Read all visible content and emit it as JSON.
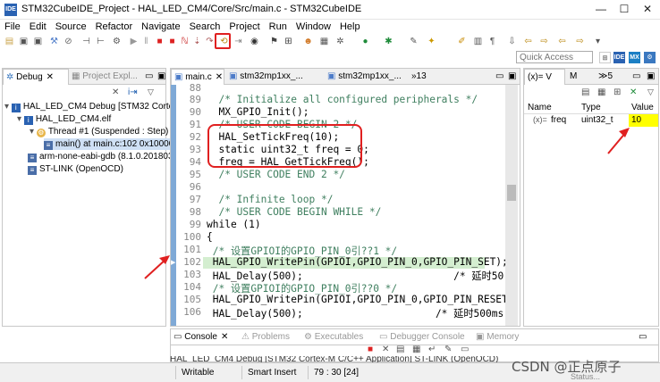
{
  "window": {
    "title": "STM32CubeIDE_Project - HAL_LED_CM4/Core/Src/main.c - STM32CubeIDE",
    "minimize": "—",
    "maximize": "☐",
    "close": "✕",
    "ide_icon": "IDE"
  },
  "menu": [
    "File",
    "Edit",
    "Source",
    "Refactor",
    "Navigate",
    "Search",
    "Project",
    "Run",
    "Window",
    "Help"
  ],
  "quick_access": {
    "placeholder": "Quick Access"
  },
  "debug_panel": {
    "tabs": [
      {
        "label": "Debug"
      },
      {
        "label": "Project Expl..."
      }
    ],
    "tree": [
      {
        "label": "HAL_LED_CM4 Debug [STM32 Cortex",
        "icon": "ide"
      },
      {
        "label": "HAL_LED_CM4.elf",
        "icon": "elf"
      },
      {
        "label": "Thread #1 (Suspended : Step)",
        "icon": "thread"
      },
      {
        "label": "main() at main.c:102 0x10000",
        "icon": "frame"
      },
      {
        "label": "arm-none-eabi-gdb (8.1.0.201803",
        "icon": "gdb"
      },
      {
        "label": "ST-LINK (OpenOCD)",
        "icon": "stlink"
      }
    ]
  },
  "editor": {
    "tabs": [
      {
        "label": "main.c"
      },
      {
        "label": "stm32mp1xx_..."
      },
      {
        "label": "stm32mp1xx_..."
      },
      {
        "label": "»13"
      }
    ],
    "lines": [
      {
        "n": "88",
        "text": ""
      },
      {
        "n": "89",
        "text": "  /* Initialize all configured peripherals */"
      },
      {
        "n": "90",
        "text": "  MX_GPIO_Init();"
      },
      {
        "n": "91",
        "text": "  /* USER CODE BEGIN 2 */"
      },
      {
        "n": "92",
        "text": "  HAL_SetTickFreq(10);"
      },
      {
        "n": "93",
        "text": "  static uint32_t freq = 0;"
      },
      {
        "n": "94",
        "text": "  freq = HAL_GetTickFreq();"
      },
      {
        "n": "95",
        "text": "  /* USER CODE END 2 */"
      },
      {
        "n": "96",
        "text": ""
      },
      {
        "n": "97",
        "text": "  /* Infinite loop */"
      },
      {
        "n": "98",
        "text": "  /* USER CODE BEGIN WHILE */"
      },
      {
        "n": "99",
        "text": "while (1)"
      },
      {
        "n": "100",
        "text": "{"
      },
      {
        "n": "101",
        "text": " /* 设置GPIOI的GPIO_PIN_0引??1 */"
      },
      {
        "n": "102",
        "text": " HAL_GPIO_WritePin(GPIOI,GPIO_PIN_0,GPIO_PIN_SET);"
      },
      {
        "n": "103",
        "text": " HAL_Delay(500);                         /* 延时50"
      },
      {
        "n": "104",
        "text": " /* 设置GPIOI的GPIO_PIN_0引??0 */"
      },
      {
        "n": "105",
        "text": " HAL_GPIO_WritePin(GPIOI,GPIO_PIN_0,GPIO_PIN_RESET);"
      },
      {
        "n": "106",
        "text": " HAL_Delay(500);                      /* 延时500ms"
      }
    ]
  },
  "variables_panel": {
    "tabs": [
      {
        "label": "(x)= V"
      },
      {
        "label": "M"
      },
      {
        "label": "≫5"
      }
    ],
    "columns": [
      "Name",
      "Type",
      "Value"
    ],
    "rows": [
      {
        "name": "freq",
        "type": "uint32_t",
        "value": "10"
      }
    ]
  },
  "console_panel": {
    "tabs": [
      {
        "label": "Console"
      },
      {
        "label": "Problems"
      },
      {
        "label": "Executables"
      },
      {
        "label": "Debugger Console"
      },
      {
        "label": "Memory"
      }
    ],
    "status_line": "HAL_LED_CM4 Debug [STM32 Cortex-M C/C++ Application] ST-LINK (OpenOCD)"
  },
  "statusbar": {
    "writable": "Writable",
    "insert": "Smart Insert",
    "position": "79 : 30 [24]",
    "status_extra": "Status..."
  },
  "watermark": "CSDN @正点原子",
  "colors": {
    "highlight": "#d4eed0",
    "value_yellow": "#ffff00",
    "annotation_red": "#e02020"
  }
}
